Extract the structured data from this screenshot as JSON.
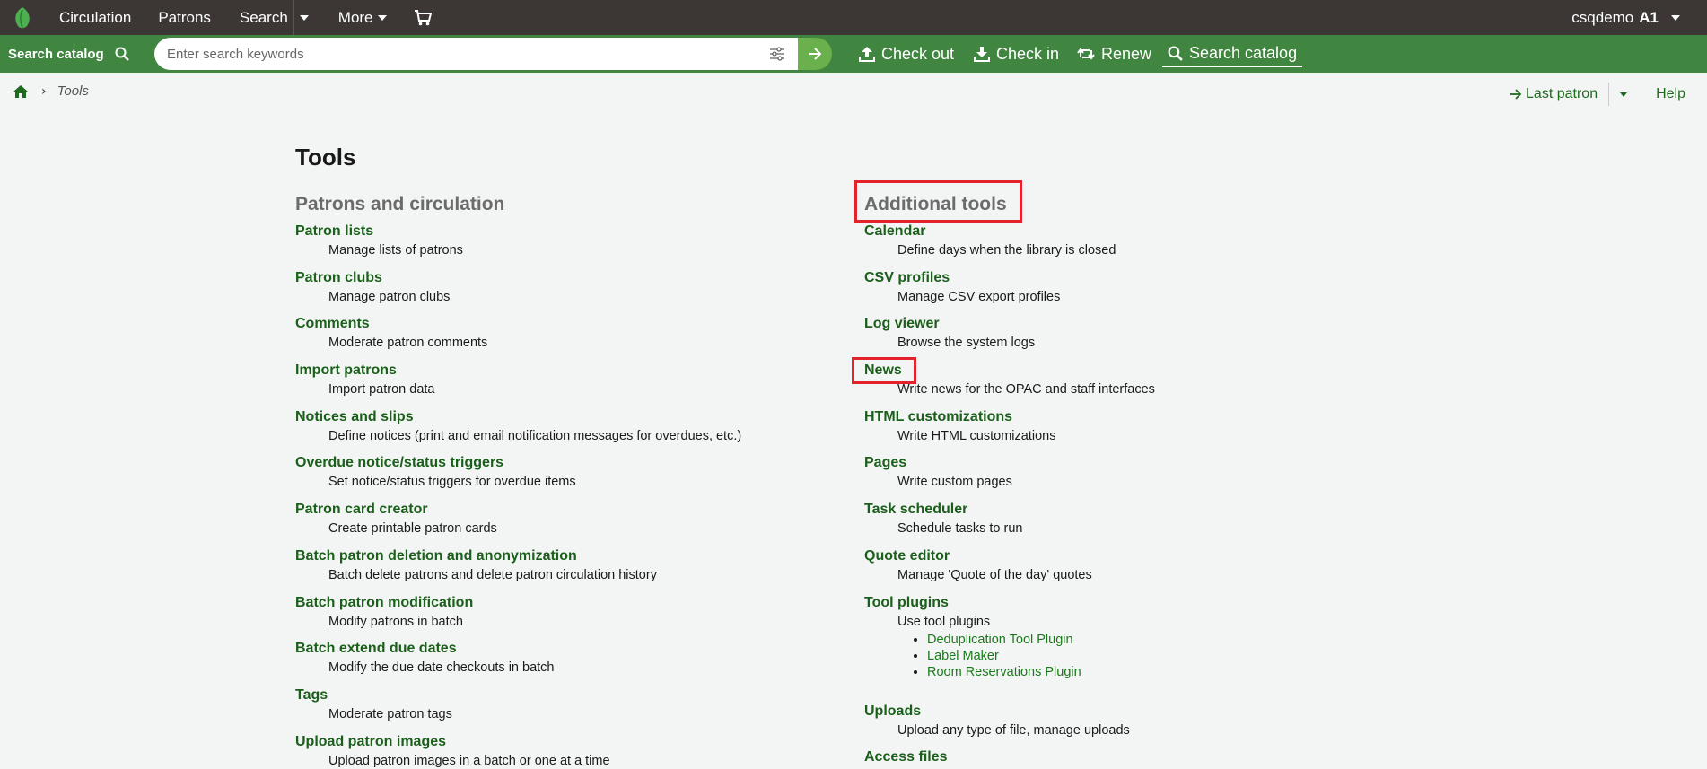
{
  "topbar": {
    "nav": [
      "Circulation",
      "Patrons",
      "Search",
      "More"
    ],
    "user": "csqdemo",
    "branch": "A1"
  },
  "searchbar": {
    "label": "Search catalog",
    "placeholder": "Enter search keywords",
    "quick_links": [
      "Check out",
      "Check in",
      "Renew",
      "Search catalog"
    ]
  },
  "breadcrumb": {
    "current": "Tools"
  },
  "header_links": {
    "last_patron": "Last patron",
    "help": "Help"
  },
  "page": {
    "title": "Tools"
  },
  "left": {
    "heading": "Patrons and circulation",
    "items": [
      {
        "title": "Patron lists",
        "desc": "Manage lists of patrons"
      },
      {
        "title": "Patron clubs",
        "desc": "Manage patron clubs"
      },
      {
        "title": "Comments",
        "desc": "Moderate patron comments"
      },
      {
        "title": "Import patrons",
        "desc": "Import patron data"
      },
      {
        "title": "Notices and slips",
        "desc": "Define notices (print and email notification messages for overdues, etc.)"
      },
      {
        "title": "Overdue notice/status triggers",
        "desc": "Set notice/status triggers for overdue items"
      },
      {
        "title": "Patron card creator",
        "desc": "Create printable patron cards"
      },
      {
        "title": "Batch patron deletion and anonymization",
        "desc": "Batch delete patrons and delete patron circulation history"
      },
      {
        "title": "Batch patron modification",
        "desc": "Modify patrons in batch"
      },
      {
        "title": "Batch extend due dates",
        "desc": "Modify the due date checkouts in batch"
      },
      {
        "title": "Tags",
        "desc": "Moderate patron tags"
      },
      {
        "title": "Upload patron images",
        "desc": "Upload patron images in a batch or one at a time"
      }
    ]
  },
  "right": {
    "heading": "Additional tools",
    "items": [
      {
        "title": "Calendar",
        "desc": "Define days when the library is closed"
      },
      {
        "title": "CSV profiles",
        "desc": "Manage CSV export profiles"
      },
      {
        "title": "Log viewer",
        "desc": "Browse the system logs"
      },
      {
        "title": "News",
        "desc": "Write news for the OPAC and staff interfaces"
      },
      {
        "title": "HTML customizations",
        "desc": "Write HTML customizations"
      },
      {
        "title": "Pages",
        "desc": "Write custom pages"
      },
      {
        "title": "Task scheduler",
        "desc": "Schedule tasks to run"
      },
      {
        "title": "Quote editor",
        "desc": "Manage 'Quote of the day' quotes"
      },
      {
        "title": "Tool plugins",
        "desc": "Use tool plugins",
        "plugins": [
          "Deduplication Tool Plugin",
          "Label Maker",
          "Room Reservations Plugin"
        ]
      },
      {
        "title": "Uploads",
        "desc": "Upload any type of file, manage uploads"
      },
      {
        "title": "Access files",
        "desc": ""
      }
    ]
  },
  "colors": {
    "topbar": "#3c3735",
    "searchbar": "#408540",
    "link": "#1a5f1a",
    "highlight": "#e3222b"
  }
}
